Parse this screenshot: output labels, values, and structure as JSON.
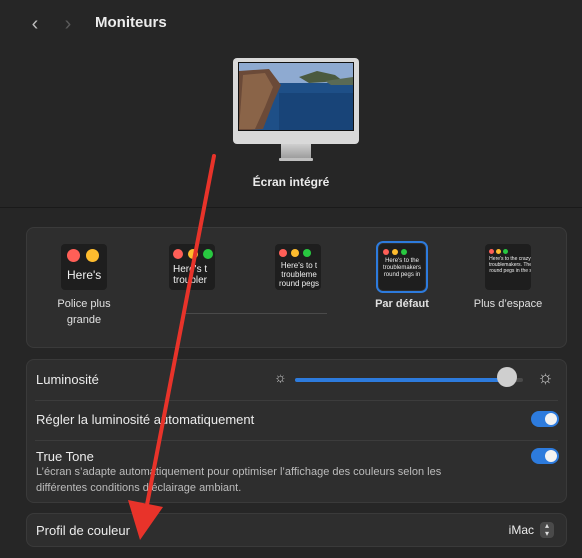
{
  "header": {
    "title": "Moniteurs",
    "back_icon": "chevron-left-icon",
    "forward_icon": "chevron-right-icon"
  },
  "display": {
    "name": "Écran intégré"
  },
  "resolution": {
    "options": [
      {
        "label": "Police plus grande",
        "thumb_text": "Here's",
        "selected": false
      },
      {
        "label": "",
        "thumb_text": "Here's t\ntroubler",
        "selected": false
      },
      {
        "label": "",
        "thumb_text": "Here's to t\ntroubleme\nround pegs",
        "selected": false
      },
      {
        "label": "Par défaut",
        "thumb_text": "Here's to the\ntroublemakers\nround pegs in",
        "selected": true
      },
      {
        "label": "Plus d’espace",
        "thumb_text": "Here's to the crazy one\ntroublemakers. The rou\nround pegs in the squa",
        "selected": false
      }
    ]
  },
  "settings": {
    "brightness_label": "Luminosité",
    "brightness_value": 0.93,
    "auto_brightness_label": "Régler la luminosité automatiquement",
    "auto_brightness_on": true,
    "true_tone_label": "True Tone",
    "true_tone_desc": "L’écran s’adapte automatiquement pour optimiser l’affichage des couleurs selon les différentes conditions d’éclairage ambiant.",
    "true_tone_on": true
  },
  "color_profile": {
    "label": "Profil de couleur",
    "value": "iMac"
  },
  "colors": {
    "accent": "#2d7bdd",
    "annotation_arrow": "#e8332a"
  }
}
